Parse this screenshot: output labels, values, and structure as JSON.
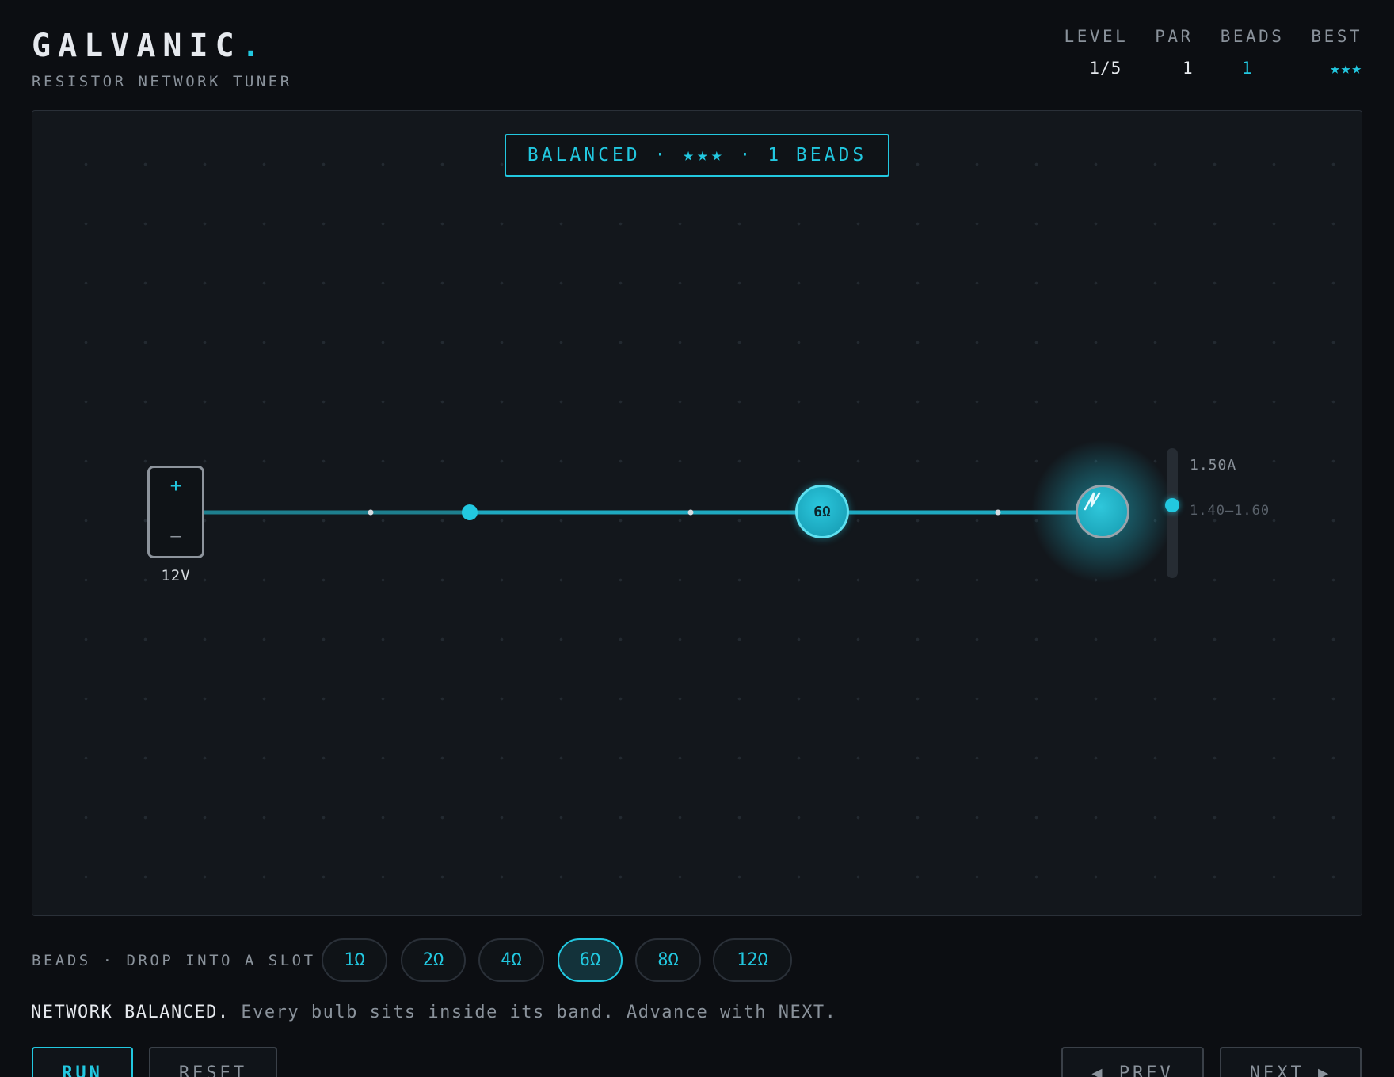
{
  "header": {
    "title": "GALVANIC",
    "title_dot": ".",
    "subtitle": "RESISTOR NETWORK TUNER"
  },
  "stats": {
    "level_label": "LEVEL",
    "level_value": "1/5",
    "par_label": "PAR",
    "par_value": "1",
    "beads_label": "BEADS",
    "beads_value": "1",
    "best_label": "BEST",
    "best_value": "★★★"
  },
  "board": {
    "status_banner": "BALANCED · ★★★ · 1 BEADS",
    "battery": {
      "plus": "+",
      "minus": "–",
      "voltage": "12V"
    },
    "bead_node_label": "6Ω",
    "meter": {
      "reading": "1.50A",
      "band": "1.40–1.60",
      "level_fraction": 0.5
    }
  },
  "tray": {
    "label": "BEADS · DROP INTO A SLOT",
    "beads": [
      "1Ω",
      "2Ω",
      "4Ω",
      "6Ω",
      "8Ω",
      "12Ω"
    ],
    "selected": "6Ω"
  },
  "message": {
    "strong": "NETWORK BALANCED.",
    "rest": "Every bulb sits inside its band. Advance with NEXT."
  },
  "buttons": {
    "run": "RUN",
    "reset": "RESET",
    "prev": "◀ PREV",
    "next": "NEXT ▶"
  },
  "colors": {
    "accent": "#22c8e0",
    "background": "#0c0e12",
    "board": "#13171c"
  },
  "icons": {
    "bulb": "filament-icon",
    "battery": "battery-icon"
  }
}
